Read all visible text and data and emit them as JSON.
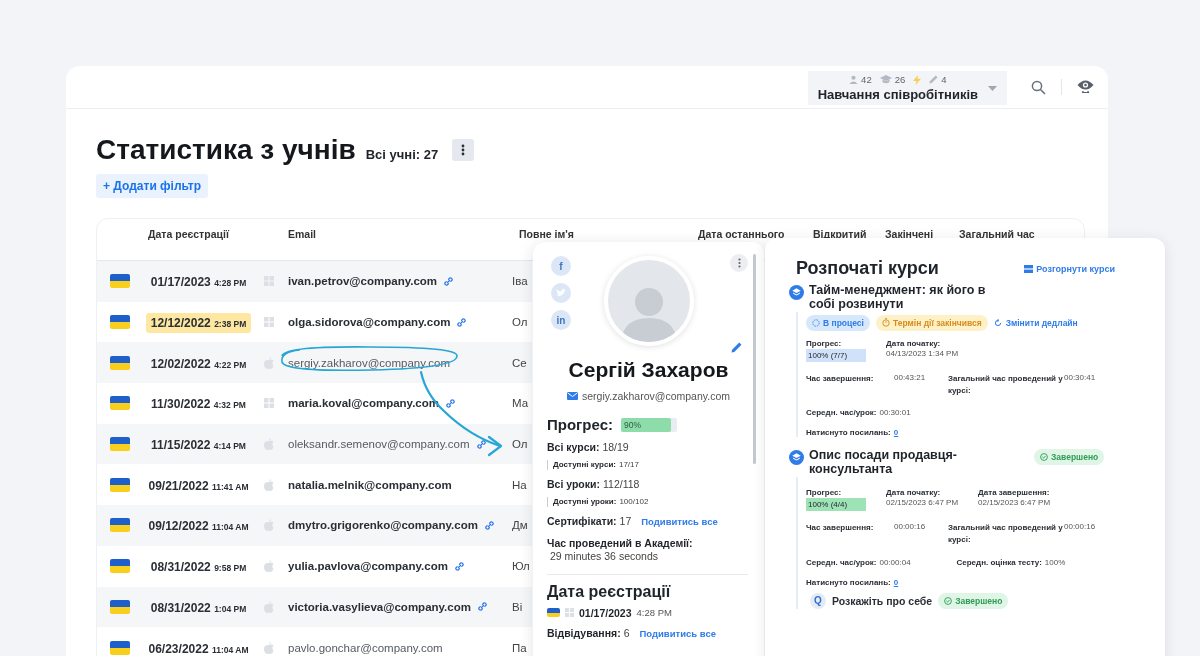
{
  "topbar": {
    "stats": [
      {
        "kind": "users",
        "value": "42"
      },
      {
        "kind": "courses",
        "value": "26"
      },
      {
        "kind": "bolt"
      },
      {
        "kind": "pencil",
        "value": "4"
      }
    ],
    "workspace": "Навчання співробітників"
  },
  "page": {
    "title": "Статистика з учнів",
    "count": "Всі учні: 27",
    "filter_button": "+ Додати фільтр"
  },
  "table": {
    "columns": [
      "Дата реєстрації",
      "Email",
      "Повне ім'я",
      "Дата останнього",
      "Відкритий",
      "Закінчені",
      "Загальний час"
    ],
    "rows": [
      {
        "date": "01/17/2023",
        "time": "4:28 PM",
        "highlighted": false,
        "kind": "windows",
        "email": "ivan.petrov@company.com",
        "dimmed": false,
        "link": true,
        "name": "Іва"
      },
      {
        "date": "12/12/2022",
        "time": "2:38 PM",
        "highlighted": true,
        "kind": "windows",
        "email": "olga.sidorova@company.com",
        "dimmed": false,
        "link": true,
        "name": "Ол"
      },
      {
        "date": "12/02/2022",
        "time": "4:22 PM",
        "highlighted": false,
        "kind": "apple",
        "email": "sergiy.zakharov@company.com",
        "dimmed": true,
        "link": false,
        "name": "Се"
      },
      {
        "date": "11/30/2022",
        "time": "4:32 PM",
        "highlighted": false,
        "kind": "windows",
        "email": "maria.koval@company.com",
        "dimmed": false,
        "link": true,
        "name": "Ма"
      },
      {
        "date": "11/15/2022",
        "time": "4:14 PM",
        "highlighted": false,
        "kind": "apple",
        "email": "oleksandr.semenov@company.com",
        "dimmed": true,
        "link": true,
        "name": "Ол"
      },
      {
        "date": "09/21/2022",
        "time": "11:41 AM",
        "highlighted": false,
        "kind": "apple",
        "email": "natalia.melnik@company.com",
        "dimmed": false,
        "link": false,
        "name": "На"
      },
      {
        "date": "09/12/2022",
        "time": "11:04 AM",
        "highlighted": false,
        "kind": "apple",
        "email": "dmytro.grigorenko@company.com",
        "dimmed": false,
        "link": true,
        "name": "Дм"
      },
      {
        "date": "08/31/2022",
        "time": "9:58 PM",
        "highlighted": false,
        "kind": "apple",
        "email": "yulia.pavlova@company.com",
        "dimmed": false,
        "link": true,
        "name": "Юл"
      },
      {
        "date": "08/31/2022",
        "time": "1:04 PM",
        "highlighted": false,
        "kind": "apple",
        "email": "victoria.vasylieva@company.com",
        "dimmed": false,
        "link": true,
        "name": "Ві"
      },
      {
        "date": "06/23/2022",
        "time": "11:04 AM",
        "highlighted": false,
        "kind": "apple",
        "email": "pavlo.gonchar@company.com",
        "dimmed": true,
        "link": false,
        "name": "Па"
      }
    ]
  },
  "profile": {
    "socials": [
      {
        "kind": "text",
        "label": "f"
      },
      {
        "kind": "bird"
      },
      {
        "kind": "text",
        "label": "in"
      }
    ],
    "name": "Сергій Захаров",
    "email": "sergiy.zakharov@company.com",
    "progress": {
      "label": "Прогрес:",
      "level": 0.9,
      "reading": "90%"
    },
    "stats": [
      {
        "kind": "main",
        "label": "Всі курси:",
        "value": "18/19"
      },
      {
        "kind": "sub",
        "label": "Доступні курси:",
        "value": "17/17"
      },
      {
        "kind": "main",
        "label": "Всі уроки:",
        "value": "112/118"
      },
      {
        "kind": "sub",
        "label": "Доступні уроки:",
        "value": "100/102"
      },
      {
        "kind": "main",
        "label": "Сертифікати:",
        "value": "17",
        "link": "Подивитись все"
      },
      {
        "kind": "main",
        "label": "Час проведений в Академії:",
        "value": "29 minutes 36 seconds"
      }
    ],
    "registration": {
      "title": "Дата реєстрації",
      "kind": "windows",
      "date": "01/17/2023",
      "time": "4:28 PM",
      "visits_label": "Відвідування:",
      "visits": "6",
      "link": "Подивитись все"
    }
  },
  "courses": {
    "title": "Розпочаті курси",
    "expand_link": "Розгорнути курси",
    "items": [
      {
        "title": "Тайм-менеджмент: як його в собі розвинути",
        "kind": "in_progress",
        "badges": [
          {
            "kind": "progress",
            "label": "В процесі"
          },
          {
            "kind": "expired",
            "label": "Термін дії закінчився"
          }
        ],
        "action": "Змінити дедлайн",
        "dates": [
          {
            "kind": "progress",
            "label": "Прогрес:",
            "value": "100% (7/7)"
          },
          {
            "kind": "date",
            "label": "Дата початку:",
            "value": "04/13/2023 1:34 PM"
          }
        ],
        "metrics": [
          [
            {
              "kind": "split",
              "label": "Час завершення:",
              "value": "00:43:21"
            },
            {
              "kind": "split",
              "label": "Загальний час проведений у курсі:",
              "value": "00:30:41"
            }
          ],
          [
            {
              "kind": "inline",
              "label": "Середн. час/урок:",
              "value": "00:30:01"
            }
          ],
          [
            {
              "kind": "link",
              "label": "Натиснуто посилань:",
              "value": "0"
            }
          ]
        ]
      },
      {
        "title": "Опис посади продавця-консультанта",
        "kind": "done",
        "title_badge": {
          "kind": "done",
          "label": "Завершено"
        },
        "dates": [
          {
            "kind": "progress",
            "label": "Прогрес:",
            "value": "100% (4/4)"
          },
          {
            "kind": "date",
            "label": "Дата початку:",
            "value": "02/15/2023 6:47 PM"
          },
          {
            "kind": "date",
            "label": "Дата завершення:",
            "value": "02/15/2023 6:47 PM"
          }
        ],
        "metrics": [
          [
            {
              "kind": "split",
              "label": "Час завершення:",
              "value": "00:00:16"
            },
            {
              "kind": "split",
              "label": "Загальний час проведений у курсі:",
              "value": "00:00:16"
            }
          ],
          [
            {
              "kind": "inline",
              "label": "Середн. час/урок:",
              "value": "00:00:04"
            },
            {
              "kind": "inline",
              "label": "Середн. оцінка тесту:",
              "value": "100%"
            }
          ],
          [
            {
              "kind": "link",
              "label": "Натиснуто посилань:",
              "value": "0"
            }
          ]
        ],
        "lessons": [
          {
            "icon": "Q",
            "title": "Розкажіть про себе",
            "badge": {
              "kind": "done",
              "label": "Завершено"
            }
          }
        ]
      }
    ]
  }
}
